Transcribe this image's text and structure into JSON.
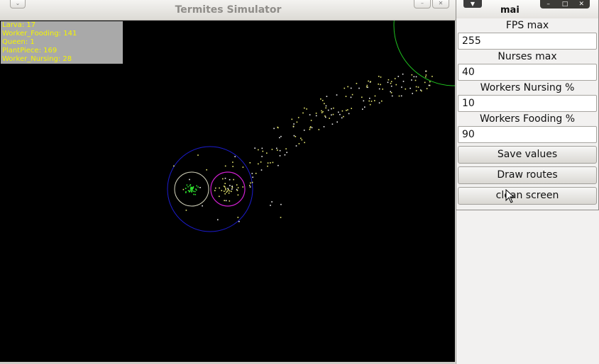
{
  "sim_window": {
    "title": "Termites Simulator",
    "menu_glyph": "⌄",
    "control_glyphs": [
      "–",
      "✕"
    ]
  },
  "stats": {
    "lines": [
      "Larva: 17",
      "Worker_Fooding: 141",
      "Queen: 1",
      "PlantPiece: 169",
      "Worker_Nursing: 28"
    ],
    "text_color": "#f5f500",
    "background": "#a9a9a9"
  },
  "canvas": {
    "background": "#000000",
    "nest_circle_color": "#1c1cd0",
    "larva_circle_color": "#d8d8c0",
    "nursery_circle_color": "#d020d0",
    "food_circle_color": "#1fc01f",
    "termite_colors": [
      "#e8e870",
      "#f0f0f0",
      "#2edf2e"
    ]
  },
  "param_window": {
    "title": "mai",
    "menu_glyph": "▼",
    "controls": [
      "–",
      "□",
      "✕"
    ],
    "fields": [
      {
        "label": "FPS max",
        "value": "255"
      },
      {
        "label": "Nurses max",
        "value": "40"
      },
      {
        "label": "Workers Nursing %",
        "value": "10"
      },
      {
        "label": "Workers Fooding %",
        "value": "90"
      }
    ],
    "buttons": [
      "Save values",
      "Draw routes",
      "clean screen"
    ]
  }
}
